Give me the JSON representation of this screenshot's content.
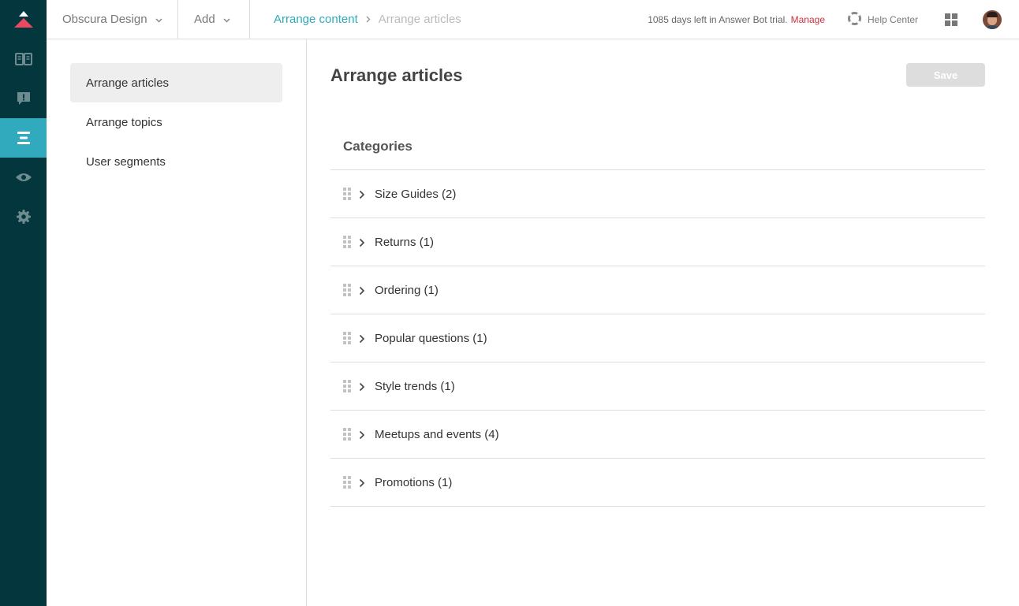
{
  "colors": {
    "rail_bg": "#03363d",
    "rail_active": "#30aabc",
    "link": "#30aabc",
    "manage": "#cc3340",
    "logo": "#eb4962"
  },
  "rail": {
    "items": [
      {
        "icon": "book-icon",
        "label": "Guide"
      },
      {
        "icon": "alert-icon",
        "label": "Moderation"
      },
      {
        "icon": "arrange-icon",
        "label": "Arrange content",
        "active": true
      },
      {
        "icon": "eye-icon",
        "label": "Preview"
      },
      {
        "icon": "gear-icon",
        "label": "Settings"
      }
    ]
  },
  "topbar": {
    "brand": "Obscura Design",
    "add": "Add",
    "breadcrumb": {
      "parent": "Arrange content",
      "current": "Arrange articles"
    },
    "trial_text": "1085 days left in Answer Bot trial.",
    "manage": "Manage",
    "help_center": "Help Center"
  },
  "subnav": {
    "items": [
      {
        "label": "Arrange articles",
        "active": true
      },
      {
        "label": "Arrange topics"
      },
      {
        "label": "User segments"
      }
    ]
  },
  "main": {
    "title": "Arrange articles",
    "save_label": "Save",
    "categories_header": "Categories",
    "categories": [
      {
        "label": "Size Guides (2)"
      },
      {
        "label": "Returns (1)"
      },
      {
        "label": "Ordering (1)"
      },
      {
        "label": "Popular questions (1)"
      },
      {
        "label": "Style trends (1)"
      },
      {
        "label": "Meetups and events (4)"
      },
      {
        "label": "Promotions (1)"
      }
    ]
  }
}
